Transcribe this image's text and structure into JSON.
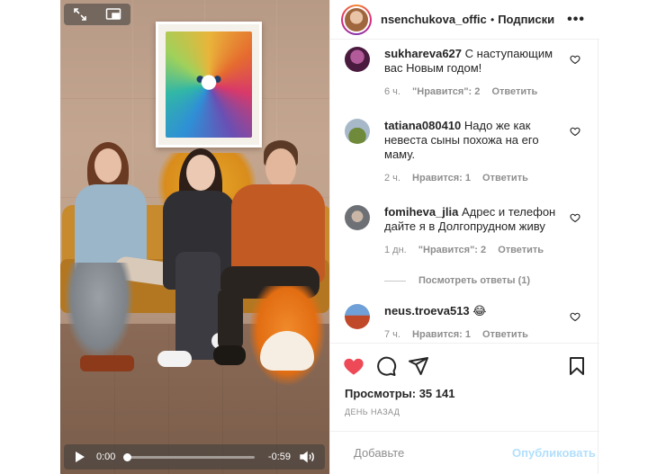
{
  "video": {
    "current_time": "0:00",
    "remaining_time": "-0:59",
    "progress_fraction": 0.0
  },
  "header": {
    "username": "nsenchukova_official",
    "separator": "•",
    "follow_label": "Подписки",
    "more_label": "•••"
  },
  "comments": [
    {
      "username": "sukhareva627",
      "text": "С наступающим вас Новым годом!",
      "time": "6 ч.",
      "likes": "\"Нравится\": 2",
      "reply": "Ответить",
      "avatar_color": "#7a2f6b"
    },
    {
      "username": "tatiana080410",
      "text": "Надо же как невеста сыны похожа на его маму.",
      "time": "2 ч.",
      "likes": "Нравится: 1",
      "reply": "Ответить",
      "avatar_color": "#5c6b2f"
    },
    {
      "username": "fomiheva_jlia",
      "text": "Адрес и телефон дайте я в Долгопрудном живу",
      "time": "1 дн.",
      "likes": "\"Нравится\": 2",
      "reply": "Ответить",
      "avatar_color": "#8a8f96"
    },
    {
      "username": "neus.troeva513",
      "text": "😂",
      "time": "7 ч.",
      "likes": "Нравится: 1",
      "reply": "Ответить",
      "avatar_color": "#c0492a"
    }
  ],
  "view_replies": "Посмотреть ответы (1)",
  "actions": {
    "like_icon": "heart-filled-icon",
    "comment_icon": "comment-icon",
    "share_icon": "paper-plane-icon",
    "save_icon": "bookmark-icon",
    "like_color": "#ed4956"
  },
  "stats": {
    "views": "Просмотры: 35 141",
    "date": "ДЕНЬ НАЗАД"
  },
  "composer": {
    "placeholder": "Добавьте",
    "post_label": "Опубликовать",
    "post_color": "#b2dffc"
  }
}
